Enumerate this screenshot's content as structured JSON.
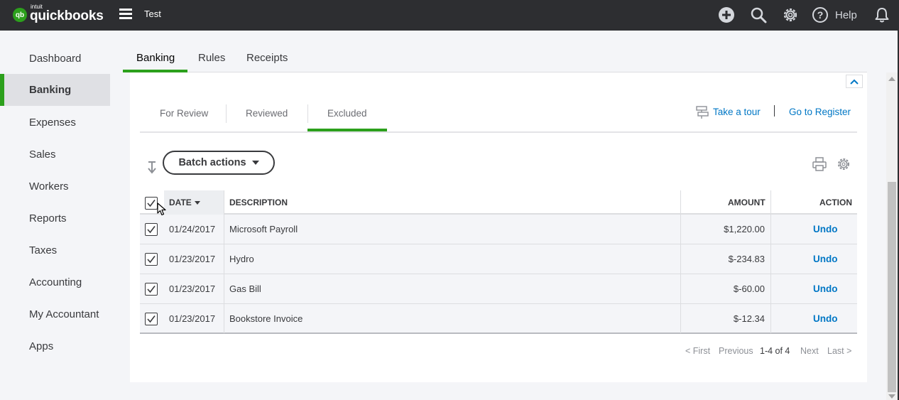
{
  "topbar": {
    "logo_badge": "qb",
    "logo_intuit": "intuit",
    "logo_brand": "quickbooks",
    "company_name": "Test",
    "help_label": "Help",
    "icons": [
      "plus-circle-icon",
      "search-icon",
      "gear-icon",
      "help-circle-icon",
      "bell-icon"
    ],
    "bg_color": "#2d2e31"
  },
  "sidebar": {
    "items": [
      {
        "label": "Dashboard"
      },
      {
        "label": "Banking",
        "active": true
      },
      {
        "label": "Expenses"
      },
      {
        "label": "Sales"
      },
      {
        "label": "Workers"
      },
      {
        "label": "Reports"
      },
      {
        "label": "Taxes"
      },
      {
        "label": "Accounting"
      },
      {
        "label": "My Accountant"
      },
      {
        "label": "Apps"
      }
    ],
    "accent_color": "#2ca01c"
  },
  "top_tabs": [
    {
      "label": "Banking",
      "active": true
    },
    {
      "label": "Rules"
    },
    {
      "label": "Receipts"
    }
  ],
  "sub_tabs": [
    {
      "label": "For Review"
    },
    {
      "label": "Reviewed"
    },
    {
      "label": "Excluded",
      "active": true
    }
  ],
  "links": {
    "take_tour": "Take a tour",
    "go_to_register": "Go to Register",
    "link_color": "#0077c5"
  },
  "toolbar": {
    "batch_actions_label": "Batch actions"
  },
  "table": {
    "columns": [
      "DATE",
      "DESCRIPTION",
      "AMOUNT",
      "ACTION"
    ],
    "select_all_checked": true,
    "sort_column": "DATE",
    "rows": [
      {
        "checked": true,
        "date": "01/24/2017",
        "description": "Microsoft Payroll",
        "amount": "$1,220.00",
        "action": "Undo"
      },
      {
        "checked": true,
        "date": "01/23/2017",
        "description": "Hydro",
        "amount": "$-234.83",
        "action": "Undo"
      },
      {
        "checked": true,
        "date": "01/23/2017",
        "description": "Gas Bill",
        "amount": "$-60.00",
        "action": "Undo"
      },
      {
        "checked": true,
        "date": "01/23/2017",
        "description": "Bookstore Invoice",
        "amount": "$-12.34",
        "action": "Undo"
      }
    ]
  },
  "pager": {
    "first": "< First",
    "previous": "Previous",
    "range": "1-4 of 4",
    "next": "Next",
    "last": "Last >"
  }
}
